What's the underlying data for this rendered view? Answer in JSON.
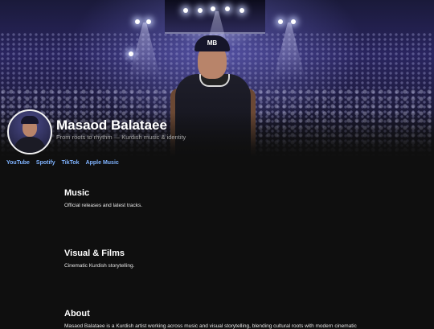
{
  "profile": {
    "name": "Masaod Balataee",
    "tagline": "From roots to rhythm — Kurdish music & identity"
  },
  "links": [
    {
      "label": "YouTube"
    },
    {
      "label": "Spotify"
    },
    {
      "label": "TikTok"
    },
    {
      "label": "Apple Music"
    }
  ],
  "hero": {
    "cap_text": "MB"
  },
  "sections": {
    "music": {
      "title": "Music",
      "text": "Official releases and latest tracks."
    },
    "visual": {
      "title": "Visual & Films",
      "text": "Cinematic Kurdish storytelling."
    },
    "about": {
      "title": "About",
      "text": "Masaod Balataee is a Kurdish artist working across music and visual storytelling, blending cultural roots with modern cinematic"
    }
  },
  "colors": {
    "background": "#0f0f0f",
    "link": "#7fb3ff",
    "tagline": "#a8a8a8"
  }
}
